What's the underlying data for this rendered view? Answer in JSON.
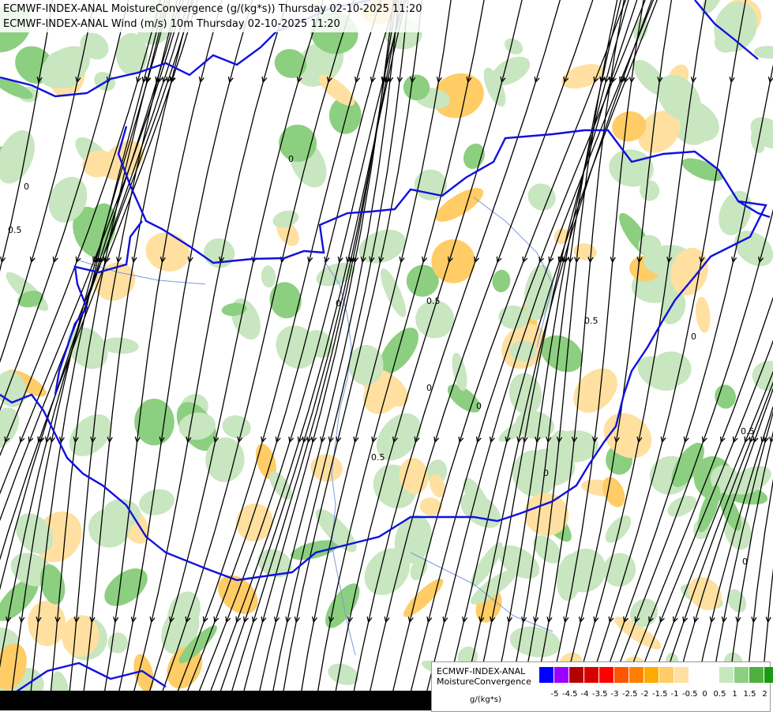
{
  "titles": {
    "line1": "ECMWF-INDEX-ANAL MoistureConvergence (g/(kg*s)) Thursday 02-10-2025 11:20",
    "line2": "ECMWF-INDEX-ANAL Wind (m/s) 10m Thursday 02-10-2025 11:20"
  },
  "legend": {
    "title_line1": "ECMWF-INDEX-ANAL",
    "title_line2": "MoistureConvergence",
    "unit": "g/(kg*s)",
    "colors": [
      "#0000ff",
      "#9900ff",
      "#b30000",
      "#d90000",
      "#ff0000",
      "#ff5500",
      "#ff8000",
      "#ffaa00",
      "#ffcc66",
      "#ffe0a0",
      "#ffffff",
      "#ffffff",
      "#c8e6c0",
      "#8ccf80",
      "#4fb040",
      "#1a9a10"
    ],
    "ticks": [
      "-5",
      "-4.5",
      "-4",
      "-3.5",
      "-3",
      "-2.5",
      "-2",
      "-1.5",
      "-1",
      "-0.5",
      "0",
      "0.5",
      "1",
      "1.5",
      "2"
    ]
  },
  "contour_labels": [
    "0",
    "0.5",
    "0",
    "0",
    "0.5",
    "0",
    "0",
    "0.5",
    "0",
    "0.5",
    "0",
    "0.5",
    "0"
  ],
  "colors": {
    "border": "#1010e0",
    "river": "#7a9ae0",
    "streamline": "#000000",
    "green_light": "#c8e6c0",
    "green_mid": "#8ccf80",
    "orange_light": "#ffe0a0",
    "orange_mid": "#ffcc66"
  }
}
